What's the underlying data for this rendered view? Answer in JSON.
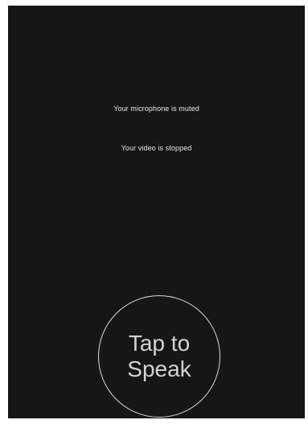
{
  "status": {
    "microphone": "Your microphone is muted",
    "video": "Your video is stopped"
  },
  "speak_button": {
    "line1": "Tap to",
    "line2": "Speak"
  },
  "colors": {
    "background": "#161616",
    "text": "#e9e9e9",
    "button_border": "#d9d9d9"
  }
}
